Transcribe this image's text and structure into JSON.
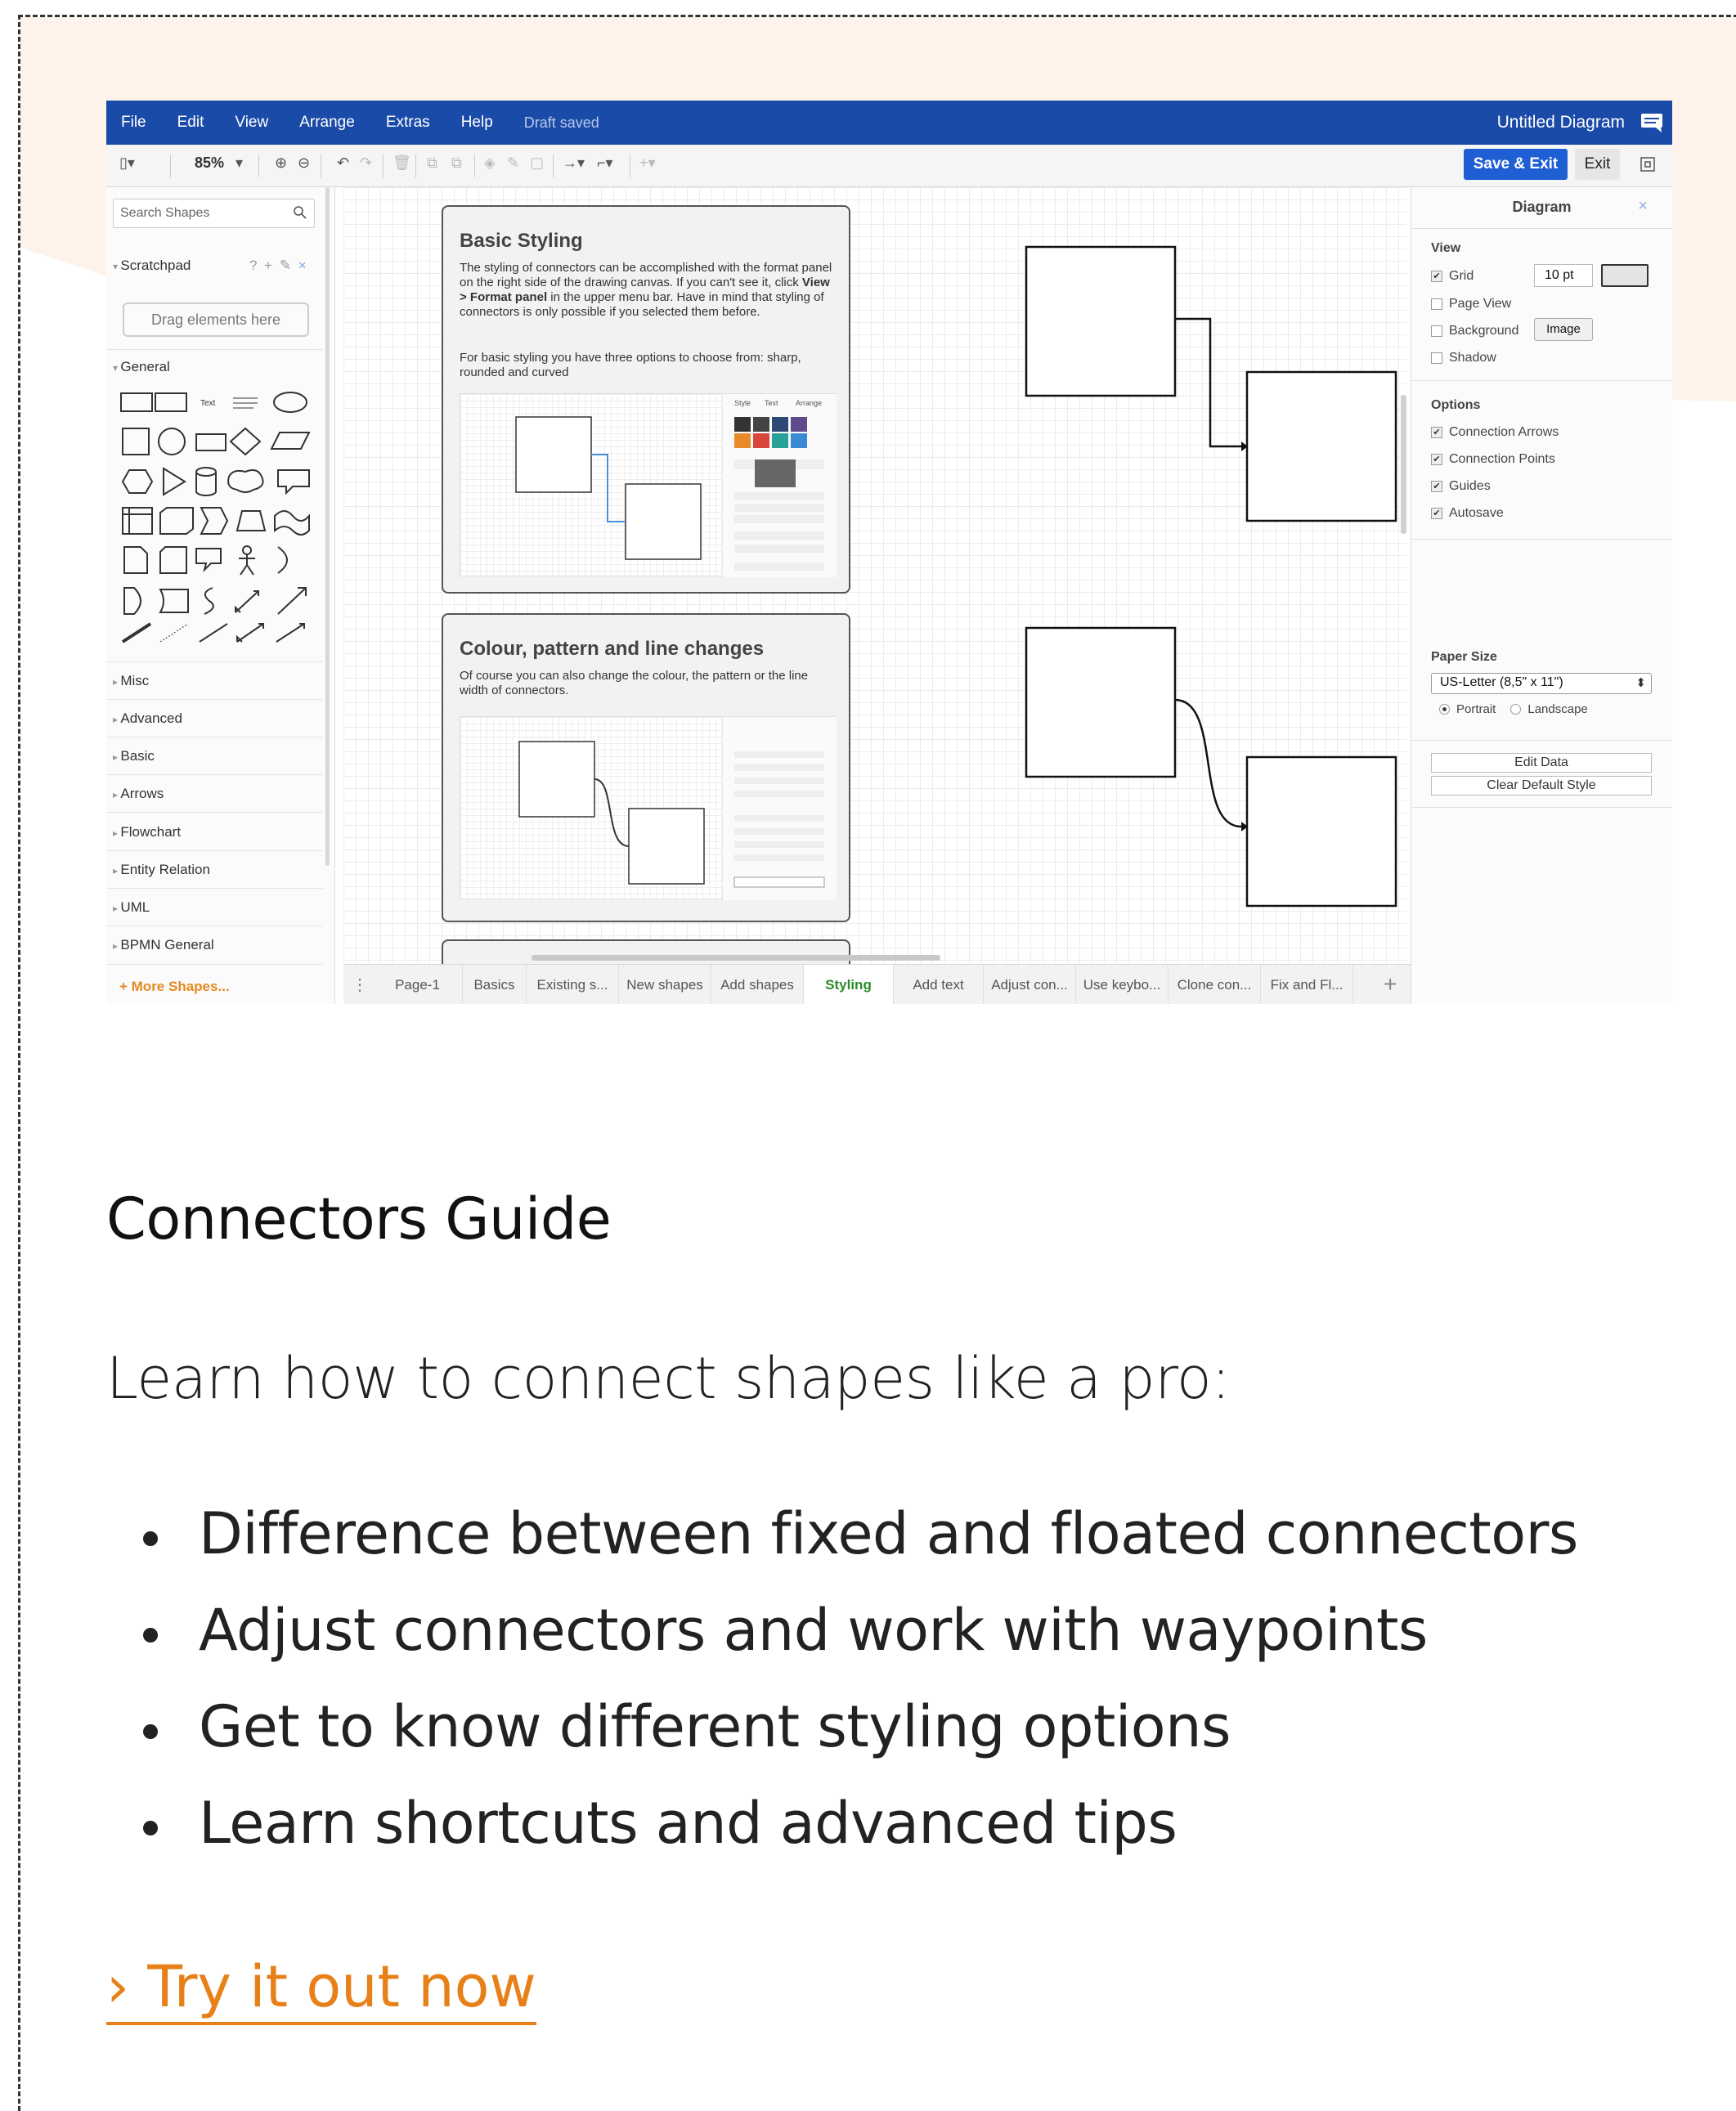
{
  "app": {
    "menu": [
      "File",
      "Edit",
      "View",
      "Arrange",
      "Extras",
      "Help"
    ],
    "draft_status": "Draft saved",
    "doc_title": "Untitled Diagram",
    "toolbar": {
      "zoom": "85%",
      "save_exit": "Save & Exit",
      "exit": "Exit"
    },
    "sidebar": {
      "search_placeholder": "Search Shapes",
      "scratchpad": "Scratchpad",
      "drag_hint": "Drag elements here",
      "general": "General",
      "sections": [
        "Misc",
        "Advanced",
        "Basic",
        "Arrows",
        "Flowchart",
        "Entity Relation",
        "UML",
        "BPMN General"
      ],
      "more_shapes": "+ More Shapes..."
    },
    "canvas": {
      "card1": {
        "title": "Basic Styling",
        "text1_a": "The styling of connectors can be accomplished with the format panel on the right side of the drawing canvas. If you can't see it, click ",
        "text1_bold": "View > Format panel",
        "text1_b": " in the upper menu bar. Have in mind that styling of connectors is only possible if you selected them before.",
        "text2": "For basic styling you have three options to choose from: sharp, rounded and curved"
      },
      "card2": {
        "title": "Colour, pattern and line changes",
        "text": "Of course you can also change the colour, the pattern or the line width of connectors."
      }
    },
    "format_panel": {
      "title": "Diagram",
      "view_heading": "View",
      "grid": "Grid",
      "grid_size": "10 pt",
      "page_view": "Page View",
      "background": "Background",
      "image_button": "Image",
      "shadow": "Shadow",
      "options_heading": "Options",
      "connection_arrows": "Connection Arrows",
      "connection_points": "Connection Points",
      "guides": "Guides",
      "autosave": "Autosave",
      "paper_heading": "Paper Size",
      "paper_size": "US-Letter (8,5\" x 11\")",
      "portrait": "Portrait",
      "landscape": "Landscape",
      "edit_data": "Edit Data",
      "clear_style": "Clear Default Style"
    },
    "tabs": [
      "Page-1",
      "Basics",
      "Existing s...",
      "New shapes",
      "Add shapes",
      "Styling",
      "Add text",
      "Adjust con...",
      "Use keybo...",
      "Clone con...",
      "Fix and Fl..."
    ],
    "active_tab": "Styling"
  },
  "content": {
    "title": "Connectors Guide",
    "intro": "Learn how to connect shapes like a pro:",
    "bullets": [
      "Difference between fixed and floated connectors",
      "Adjust connectors and work with waypoints",
      "Get to know different styling options",
      "Learn shortcuts and advanced tips"
    ],
    "cta": "› Try it out now"
  },
  "colors": {
    "menubar": "#1b4ba8",
    "save_button": "#1f5fd4",
    "cta": "#e8801a",
    "active_tab": "#2a8c2a",
    "card_bg": "#fdf3ea"
  }
}
